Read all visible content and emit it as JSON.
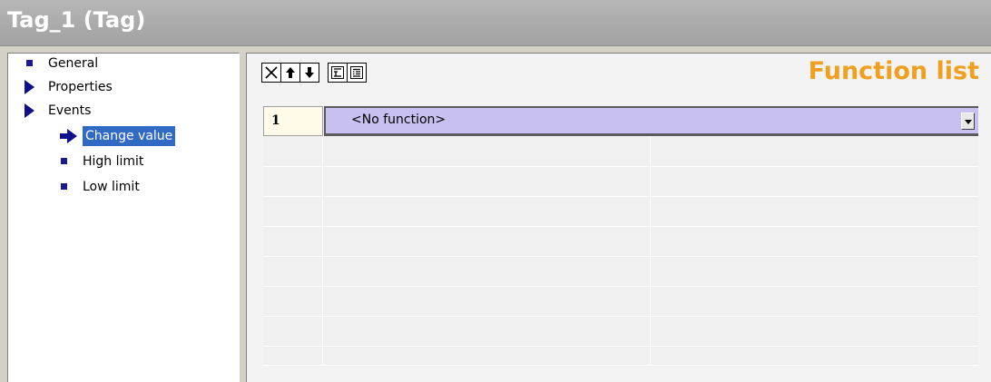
{
  "window": {
    "title": "Tag_1 (Tag)"
  },
  "tree": {
    "items": [
      {
        "label": "General"
      },
      {
        "label": "Properties"
      },
      {
        "label": "Events"
      },
      {
        "label": "Change value"
      },
      {
        "label": "High limit"
      },
      {
        "label": "Low limit"
      }
    ]
  },
  "toolbar": {
    "buttons": [
      "delete-icon",
      "move-up-icon",
      "move-down-icon",
      "indent-icon",
      "list-icon"
    ]
  },
  "function_list": {
    "title": "Function list",
    "rows": [
      {
        "num": "1",
        "value": "<No function>"
      }
    ]
  },
  "colors": {
    "title_text": "#ffffff",
    "heading": "#f0a020",
    "selected_row": "#c8c0f0",
    "tree_selection": "#316ac5"
  }
}
